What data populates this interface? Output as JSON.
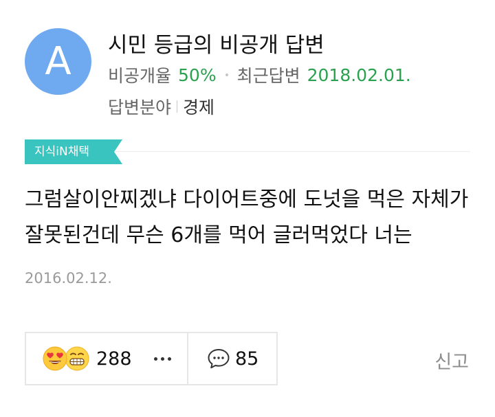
{
  "profile": {
    "avatar_letter": "A",
    "avatar_color": "#6fa9ef",
    "name": "시민 등급의 비공개 답변",
    "private_rate_label": "비공개율",
    "private_rate_value": "50%",
    "recent_answer_label": "최근답변",
    "recent_answer_value": "2018.02.01.",
    "field_label": "답변분야",
    "field_value": "경제"
  },
  "badge": {
    "label": "지식iN채택",
    "color": "#3ac4bf"
  },
  "answer": {
    "text": "그럼살이안찌겠냐 다이어트중에 도넛을 먹은 자체가 잘못된건데 무슨 6개를 먹어 글러먹었다 너는",
    "date": "2016.02.12."
  },
  "actions": {
    "reaction_icons": [
      "heart-eyes-emoji-icon",
      "grinning-emoji-icon"
    ],
    "reaction_count": "288",
    "more_icon": "ellipsis-icon",
    "comment_icon": "speech-bubble-icon",
    "comment_count": "85",
    "report_label": "신고"
  },
  "colors": {
    "accent_green": "#2aa14f",
    "muted_text": "#666666",
    "date_text": "#9a9a9a",
    "border": "#e6e6e6"
  }
}
